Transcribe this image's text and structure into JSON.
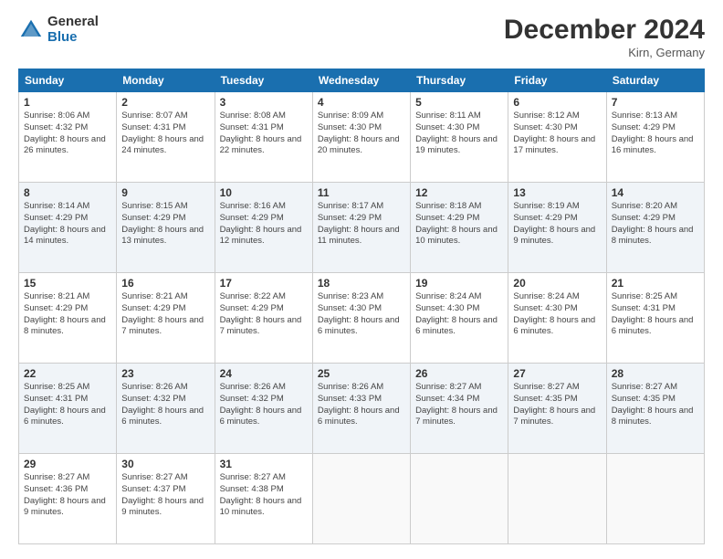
{
  "logo": {
    "general": "General",
    "blue": "Blue"
  },
  "header": {
    "title": "December 2024",
    "location": "Kirn, Germany"
  },
  "days_of_week": [
    "Sunday",
    "Monday",
    "Tuesday",
    "Wednesday",
    "Thursday",
    "Friday",
    "Saturday"
  ],
  "weeks": [
    [
      {
        "day": 1,
        "sunrise": "8:06 AM",
        "sunset": "4:32 PM",
        "daylight": "8 hours and 26 minutes."
      },
      {
        "day": 2,
        "sunrise": "8:07 AM",
        "sunset": "4:31 PM",
        "daylight": "8 hours and 24 minutes."
      },
      {
        "day": 3,
        "sunrise": "8:08 AM",
        "sunset": "4:31 PM",
        "daylight": "8 hours and 22 minutes."
      },
      {
        "day": 4,
        "sunrise": "8:09 AM",
        "sunset": "4:30 PM",
        "daylight": "8 hours and 20 minutes."
      },
      {
        "day": 5,
        "sunrise": "8:11 AM",
        "sunset": "4:30 PM",
        "daylight": "8 hours and 19 minutes."
      },
      {
        "day": 6,
        "sunrise": "8:12 AM",
        "sunset": "4:30 PM",
        "daylight": "8 hours and 17 minutes."
      },
      {
        "day": 7,
        "sunrise": "8:13 AM",
        "sunset": "4:29 PM",
        "daylight": "8 hours and 16 minutes."
      }
    ],
    [
      {
        "day": 8,
        "sunrise": "8:14 AM",
        "sunset": "4:29 PM",
        "daylight": "8 hours and 14 minutes."
      },
      {
        "day": 9,
        "sunrise": "8:15 AM",
        "sunset": "4:29 PM",
        "daylight": "8 hours and 13 minutes."
      },
      {
        "day": 10,
        "sunrise": "8:16 AM",
        "sunset": "4:29 PM",
        "daylight": "8 hours and 12 minutes."
      },
      {
        "day": 11,
        "sunrise": "8:17 AM",
        "sunset": "4:29 PM",
        "daylight": "8 hours and 11 minutes."
      },
      {
        "day": 12,
        "sunrise": "8:18 AM",
        "sunset": "4:29 PM",
        "daylight": "8 hours and 10 minutes."
      },
      {
        "day": 13,
        "sunrise": "8:19 AM",
        "sunset": "4:29 PM",
        "daylight": "8 hours and 9 minutes."
      },
      {
        "day": 14,
        "sunrise": "8:20 AM",
        "sunset": "4:29 PM",
        "daylight": "8 hours and 8 minutes."
      }
    ],
    [
      {
        "day": 15,
        "sunrise": "8:21 AM",
        "sunset": "4:29 PM",
        "daylight": "8 hours and 8 minutes."
      },
      {
        "day": 16,
        "sunrise": "8:21 AM",
        "sunset": "4:29 PM",
        "daylight": "8 hours and 7 minutes."
      },
      {
        "day": 17,
        "sunrise": "8:22 AM",
        "sunset": "4:29 PM",
        "daylight": "8 hours and 7 minutes."
      },
      {
        "day": 18,
        "sunrise": "8:23 AM",
        "sunset": "4:30 PM",
        "daylight": "8 hours and 6 minutes."
      },
      {
        "day": 19,
        "sunrise": "8:24 AM",
        "sunset": "4:30 PM",
        "daylight": "8 hours and 6 minutes."
      },
      {
        "day": 20,
        "sunrise": "8:24 AM",
        "sunset": "4:30 PM",
        "daylight": "8 hours and 6 minutes."
      },
      {
        "day": 21,
        "sunrise": "8:25 AM",
        "sunset": "4:31 PM",
        "daylight": "8 hours and 6 minutes."
      }
    ],
    [
      {
        "day": 22,
        "sunrise": "8:25 AM",
        "sunset": "4:31 PM",
        "daylight": "8 hours and 6 minutes."
      },
      {
        "day": 23,
        "sunrise": "8:26 AM",
        "sunset": "4:32 PM",
        "daylight": "8 hours and 6 minutes."
      },
      {
        "day": 24,
        "sunrise": "8:26 AM",
        "sunset": "4:32 PM",
        "daylight": "8 hours and 6 minutes."
      },
      {
        "day": 25,
        "sunrise": "8:26 AM",
        "sunset": "4:33 PM",
        "daylight": "8 hours and 6 minutes."
      },
      {
        "day": 26,
        "sunrise": "8:27 AM",
        "sunset": "4:34 PM",
        "daylight": "8 hours and 7 minutes."
      },
      {
        "day": 27,
        "sunrise": "8:27 AM",
        "sunset": "4:35 PM",
        "daylight": "8 hours and 7 minutes."
      },
      {
        "day": 28,
        "sunrise": "8:27 AM",
        "sunset": "4:35 PM",
        "daylight": "8 hours and 8 minutes."
      }
    ],
    [
      {
        "day": 29,
        "sunrise": "8:27 AM",
        "sunset": "4:36 PM",
        "daylight": "8 hours and 9 minutes."
      },
      {
        "day": 30,
        "sunrise": "8:27 AM",
        "sunset": "4:37 PM",
        "daylight": "8 hours and 9 minutes."
      },
      {
        "day": 31,
        "sunrise": "8:27 AM",
        "sunset": "4:38 PM",
        "daylight": "8 hours and 10 minutes."
      },
      null,
      null,
      null,
      null
    ]
  ]
}
